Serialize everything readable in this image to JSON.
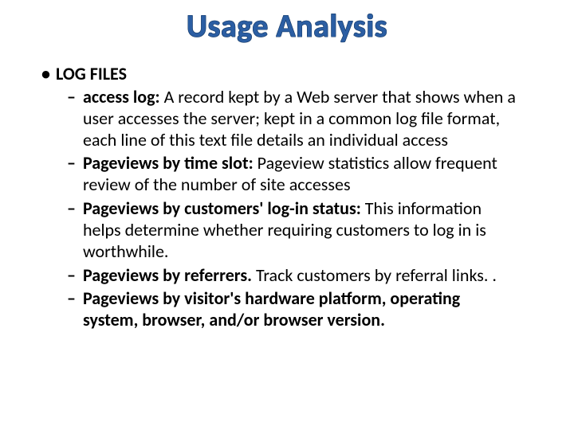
{
  "title": "Usage Analysis",
  "section_heading": "LOG FILES",
  "items": [
    {
      "label": "access log:",
      "text": "  A record kept by a Web server that shows when a user accesses the server; kept in a common log file format, each line of this text file details an individual access"
    },
    {
      "label": "Pageviews by time slot:",
      "text": " Pageview statistics allow frequent review of the number of site accesses"
    },
    {
      "label": "Pageviews by customers' log-in status:",
      "text": " This information helps determine whether requiring customers to log in is worthwhile."
    },
    {
      "label": "Pageviews by referrers.",
      "text": " Track customers by referral links. ."
    },
    {
      "label": "Pageviews by visitor's hardware platform, operating system, browser, and/or browser version.",
      "text": ""
    }
  ]
}
